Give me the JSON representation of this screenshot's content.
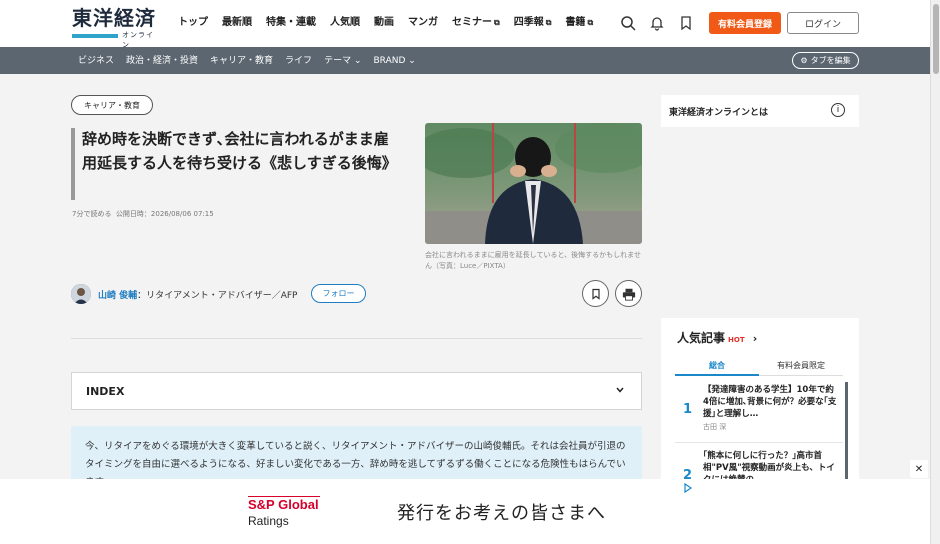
{
  "header": {
    "logo_main": "東洋経済",
    "logo_sub": "オンライン",
    "nav": [
      "トップ",
      "最新順",
      "特集・連載",
      "人気順",
      "動画",
      "マンガ",
      "セミナー",
      "四季報",
      "書籍"
    ],
    "register_label": "有料会員登録",
    "login_label": "ログイン"
  },
  "subnav": {
    "items": [
      "ビジネス",
      "政治・経済・投資",
      "キャリア・教育",
      "ライフ",
      "テーマ",
      "BRAND"
    ],
    "tab_edit_label": "タブを編集"
  },
  "article": {
    "category": "キャリア・教育",
    "title": "辞め時を決断できず､会社に言われるがまま雇用延長する人を待ち受ける《悲しすぎる後悔》",
    "read_time": "7分で読める",
    "published": "公開日時：2026/08/06 07:15",
    "caption": "会社に言われるままに雇用を延長していると、後悔するかもしれません（写真：Luce／PIXTA）",
    "author_name": "山崎 俊輔",
    "author_role": "：リタイアメント・アドバイザー／AFP",
    "follow_label": "フォロー",
    "index_label": "INDEX",
    "lead": "今、リタイアをめぐる環境が大きく変革していると説く、リタイアメント・アドバイザーの山崎俊輔氏。それは会社員が引退のタイミングを自由に選べるようになる、好ましい変化である一方、辞め時を逃してずるずる働くことになる危険性もはらんでいます。"
  },
  "sidebar": {
    "about_label": "東洋経済オンラインとは",
    "popular_title": "人気記事",
    "hot_label": "HOT",
    "tab_all": "総合",
    "tab_paid": "有料会員限定",
    "ranking": [
      {
        "rank": "1",
        "title": "【発達障害のある学生】10年で約4倍に増加､背景に何が？必要な｢支援｣と理解し…",
        "author": "古田 深"
      },
      {
        "rank": "2",
        "title": "｢熊本に何しに行った？｣高市首相\"PV風\"視察動画が炎上も、トイクには絶賛の…",
        "author": ""
      }
    ]
  },
  "ad": {
    "brand_line1": "S&P Global",
    "brand_line2": "Ratings",
    "headline": "発行をお考えの皆さまへ"
  },
  "colors": {
    "accent": "#f05a16",
    "link": "#1a88c9",
    "subnav_bg": "#5b6670",
    "lead_bg": "#dff0f9"
  }
}
